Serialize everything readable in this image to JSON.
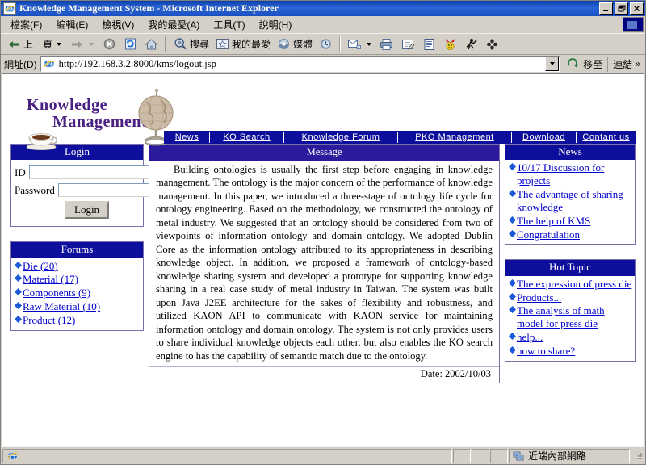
{
  "window": {
    "title": "Knowledge Management System - Microsoft Internet Explorer",
    "icon": "ie-document-icon",
    "minimize_label": "_",
    "restore_label": "❐",
    "close_label": "✕"
  },
  "menubar": {
    "items": [
      {
        "label": "檔案(F)",
        "name": "menu-file"
      },
      {
        "label": "編輯(E)",
        "name": "menu-edit"
      },
      {
        "label": "檢視(V)",
        "name": "menu-view"
      },
      {
        "label": "我的最愛(A)",
        "name": "menu-favorites"
      },
      {
        "label": "工具(T)",
        "name": "menu-tools"
      },
      {
        "label": "說明(H)",
        "name": "menu-help"
      }
    ]
  },
  "toolbar": {
    "back_label": "上一頁",
    "forward_label": "",
    "stop_label": "",
    "refresh_label": "",
    "home_label": "",
    "search_label": "搜尋",
    "favorites_label": "我的最愛",
    "media_label": "媒體",
    "history_label": "",
    "mail_label": "",
    "print_label": "",
    "edit_label": "",
    "discuss_label": "",
    "messenger_label": "",
    "research_label": "",
    "translate_label": ""
  },
  "address": {
    "label": "網址(D)",
    "url": "http://192.168.3.2:8000/kms/logout.jsp",
    "go_label": "移至",
    "links_label": "連結",
    "links_chevron": "»"
  },
  "site": {
    "logo_line1": "Knowledge",
    "logo_line2": "Management",
    "logo_color": "#4b2083",
    "nav_bg": "#0e0e9c",
    "nav": [
      {
        "label": "News",
        "name": "nav-news"
      },
      {
        "label": "KO Search",
        "name": "nav-ko-search"
      },
      {
        "label": "Knowledge Forum",
        "name": "nav-knowledge-forum"
      },
      {
        "label": "PKO Management",
        "name": "nav-pko-management"
      },
      {
        "label": "Download",
        "name": "nav-download"
      },
      {
        "label": "Contant us",
        "name": "nav-contact-us"
      }
    ]
  },
  "login": {
    "title": "Login",
    "id_label": "ID",
    "id_value": "",
    "id_placeholder": "",
    "password_label": "Password",
    "password_value": "",
    "password_placeholder": "",
    "submit_label": "Login"
  },
  "forums": {
    "title": "Forums",
    "items": [
      {
        "label": "Die (20)"
      },
      {
        "label": "Material (17)"
      },
      {
        "label": "Components (9)"
      },
      {
        "label": "Raw Material (10)"
      },
      {
        "label": "Product (12)"
      }
    ]
  },
  "message": {
    "title": "Message",
    "body": "Building ontologies is usually the first step before engaging in knowledge management. The ontology is the major concern of the performance of knowledge management. In this paper, we introduced a three-stage of ontology life cycle for ontology engineering. Based on the methodology, we constructed the ontology of metal industry. We suggested that an ontology should be considered from two of viewpoints of information ontology and domain ontology. We adopted Dublin Core as the information ontology attributed to its appropriateness in describing knowledge object. In addition, we proposed a framework of ontology-based knowledge sharing system and developed a prototype for supporting knowledge sharing in a real case study of metal industry in Taiwan. The system was built upon Java J2EE architecture for the sakes of flexibility and robustness, and utilized KAON API to communicate with KAON service for maintaining information ontology and domain ontology. The system is not only provides users to share individual knowledge objects each other, but also enables the KO search engine to has the capability of semantic match due to the ontology.",
    "date": "Date: 2002/10/03"
  },
  "news": {
    "title": "News",
    "items": [
      {
        "label": "10/17 Discussion for projects"
      },
      {
        "label": "The advantage of sharing knowledge"
      },
      {
        "label": "The help of KMS"
      },
      {
        "label": "Congratulation"
      }
    ]
  },
  "hot_topic": {
    "title": "Hot Topic",
    "items": [
      {
        "label": "The expression of press die"
      },
      {
        "label": "Products..."
      },
      {
        "label": "The analysis of math model for press die"
      },
      {
        "label": "help..."
      },
      {
        "label": "how to share?"
      }
    ]
  },
  "statusbar": {
    "message": "",
    "zone": "近端內部網路"
  }
}
